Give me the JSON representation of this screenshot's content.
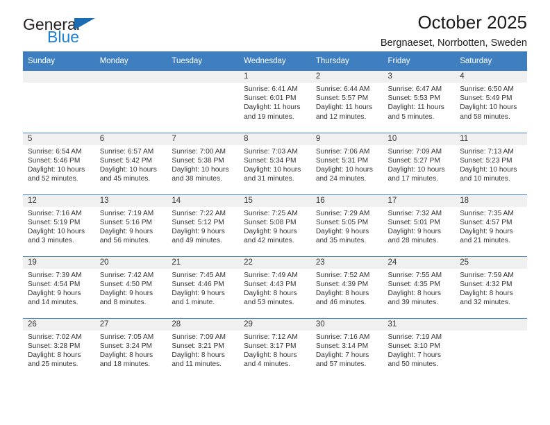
{
  "brand": {
    "name_part1": "General",
    "name_part2": "Blue",
    "triangle_color": "#1b6cb5",
    "blue_color": "#1b7fd4"
  },
  "header": {
    "title": "October 2025",
    "subtitle": "Bergnaeset, Norrbotten, Sweden"
  },
  "theme": {
    "header_bar_color": "#3f7fbf",
    "date_strip_color": "#f0f0f0",
    "text_color": "#333333"
  },
  "weekdays": [
    "Sunday",
    "Monday",
    "Tuesday",
    "Wednesday",
    "Thursday",
    "Friday",
    "Saturday"
  ],
  "weeks": [
    [
      {
        "day": "",
        "sunrise": "",
        "sunset": "",
        "daylight_line1": "",
        "daylight_line2": "",
        "empty": true
      },
      {
        "day": "",
        "sunrise": "",
        "sunset": "",
        "daylight_line1": "",
        "daylight_line2": "",
        "empty": true
      },
      {
        "day": "",
        "sunrise": "",
        "sunset": "",
        "daylight_line1": "",
        "daylight_line2": "",
        "empty": true
      },
      {
        "day": "1",
        "sunrise": "Sunrise: 6:41 AM",
        "sunset": "Sunset: 6:01 PM",
        "daylight_line1": "Daylight: 11 hours",
        "daylight_line2": "and 19 minutes."
      },
      {
        "day": "2",
        "sunrise": "Sunrise: 6:44 AM",
        "sunset": "Sunset: 5:57 PM",
        "daylight_line1": "Daylight: 11 hours",
        "daylight_line2": "and 12 minutes."
      },
      {
        "day": "3",
        "sunrise": "Sunrise: 6:47 AM",
        "sunset": "Sunset: 5:53 PM",
        "daylight_line1": "Daylight: 11 hours",
        "daylight_line2": "and 5 minutes."
      },
      {
        "day": "4",
        "sunrise": "Sunrise: 6:50 AM",
        "sunset": "Sunset: 5:49 PM",
        "daylight_line1": "Daylight: 10 hours",
        "daylight_line2": "and 58 minutes."
      }
    ],
    [
      {
        "day": "5",
        "sunrise": "Sunrise: 6:54 AM",
        "sunset": "Sunset: 5:46 PM",
        "daylight_line1": "Daylight: 10 hours",
        "daylight_line2": "and 52 minutes."
      },
      {
        "day": "6",
        "sunrise": "Sunrise: 6:57 AM",
        "sunset": "Sunset: 5:42 PM",
        "daylight_line1": "Daylight: 10 hours",
        "daylight_line2": "and 45 minutes."
      },
      {
        "day": "7",
        "sunrise": "Sunrise: 7:00 AM",
        "sunset": "Sunset: 5:38 PM",
        "daylight_line1": "Daylight: 10 hours",
        "daylight_line2": "and 38 minutes."
      },
      {
        "day": "8",
        "sunrise": "Sunrise: 7:03 AM",
        "sunset": "Sunset: 5:34 PM",
        "daylight_line1": "Daylight: 10 hours",
        "daylight_line2": "and 31 minutes."
      },
      {
        "day": "9",
        "sunrise": "Sunrise: 7:06 AM",
        "sunset": "Sunset: 5:31 PM",
        "daylight_line1": "Daylight: 10 hours",
        "daylight_line2": "and 24 minutes."
      },
      {
        "day": "10",
        "sunrise": "Sunrise: 7:09 AM",
        "sunset": "Sunset: 5:27 PM",
        "daylight_line1": "Daylight: 10 hours",
        "daylight_line2": "and 17 minutes."
      },
      {
        "day": "11",
        "sunrise": "Sunrise: 7:13 AM",
        "sunset": "Sunset: 5:23 PM",
        "daylight_line1": "Daylight: 10 hours",
        "daylight_line2": "and 10 minutes."
      }
    ],
    [
      {
        "day": "12",
        "sunrise": "Sunrise: 7:16 AM",
        "sunset": "Sunset: 5:19 PM",
        "daylight_line1": "Daylight: 10 hours",
        "daylight_line2": "and 3 minutes."
      },
      {
        "day": "13",
        "sunrise": "Sunrise: 7:19 AM",
        "sunset": "Sunset: 5:16 PM",
        "daylight_line1": "Daylight: 9 hours",
        "daylight_line2": "and 56 minutes."
      },
      {
        "day": "14",
        "sunrise": "Sunrise: 7:22 AM",
        "sunset": "Sunset: 5:12 PM",
        "daylight_line1": "Daylight: 9 hours",
        "daylight_line2": "and 49 minutes."
      },
      {
        "day": "15",
        "sunrise": "Sunrise: 7:25 AM",
        "sunset": "Sunset: 5:08 PM",
        "daylight_line1": "Daylight: 9 hours",
        "daylight_line2": "and 42 minutes."
      },
      {
        "day": "16",
        "sunrise": "Sunrise: 7:29 AM",
        "sunset": "Sunset: 5:05 PM",
        "daylight_line1": "Daylight: 9 hours",
        "daylight_line2": "and 35 minutes."
      },
      {
        "day": "17",
        "sunrise": "Sunrise: 7:32 AM",
        "sunset": "Sunset: 5:01 PM",
        "daylight_line1": "Daylight: 9 hours",
        "daylight_line2": "and 28 minutes."
      },
      {
        "day": "18",
        "sunrise": "Sunrise: 7:35 AM",
        "sunset": "Sunset: 4:57 PM",
        "daylight_line1": "Daylight: 9 hours",
        "daylight_line2": "and 21 minutes."
      }
    ],
    [
      {
        "day": "19",
        "sunrise": "Sunrise: 7:39 AM",
        "sunset": "Sunset: 4:54 PM",
        "daylight_line1": "Daylight: 9 hours",
        "daylight_line2": "and 14 minutes."
      },
      {
        "day": "20",
        "sunrise": "Sunrise: 7:42 AM",
        "sunset": "Sunset: 4:50 PM",
        "daylight_line1": "Daylight: 9 hours",
        "daylight_line2": "and 8 minutes."
      },
      {
        "day": "21",
        "sunrise": "Sunrise: 7:45 AM",
        "sunset": "Sunset: 4:46 PM",
        "daylight_line1": "Daylight: 9 hours",
        "daylight_line2": "and 1 minute."
      },
      {
        "day": "22",
        "sunrise": "Sunrise: 7:49 AM",
        "sunset": "Sunset: 4:43 PM",
        "daylight_line1": "Daylight: 8 hours",
        "daylight_line2": "and 53 minutes."
      },
      {
        "day": "23",
        "sunrise": "Sunrise: 7:52 AM",
        "sunset": "Sunset: 4:39 PM",
        "daylight_line1": "Daylight: 8 hours",
        "daylight_line2": "and 46 minutes."
      },
      {
        "day": "24",
        "sunrise": "Sunrise: 7:55 AM",
        "sunset": "Sunset: 4:35 PM",
        "daylight_line1": "Daylight: 8 hours",
        "daylight_line2": "and 39 minutes."
      },
      {
        "day": "25",
        "sunrise": "Sunrise: 7:59 AM",
        "sunset": "Sunset: 4:32 PM",
        "daylight_line1": "Daylight: 8 hours",
        "daylight_line2": "and 32 minutes."
      }
    ],
    [
      {
        "day": "26",
        "sunrise": "Sunrise: 7:02 AM",
        "sunset": "Sunset: 3:28 PM",
        "daylight_line1": "Daylight: 8 hours",
        "daylight_line2": "and 25 minutes."
      },
      {
        "day": "27",
        "sunrise": "Sunrise: 7:05 AM",
        "sunset": "Sunset: 3:24 PM",
        "daylight_line1": "Daylight: 8 hours",
        "daylight_line2": "and 18 minutes."
      },
      {
        "day": "28",
        "sunrise": "Sunrise: 7:09 AM",
        "sunset": "Sunset: 3:21 PM",
        "daylight_line1": "Daylight: 8 hours",
        "daylight_line2": "and 11 minutes."
      },
      {
        "day": "29",
        "sunrise": "Sunrise: 7:12 AM",
        "sunset": "Sunset: 3:17 PM",
        "daylight_line1": "Daylight: 8 hours",
        "daylight_line2": "and 4 minutes."
      },
      {
        "day": "30",
        "sunrise": "Sunrise: 7:16 AM",
        "sunset": "Sunset: 3:14 PM",
        "daylight_line1": "Daylight: 7 hours",
        "daylight_line2": "and 57 minutes."
      },
      {
        "day": "31",
        "sunrise": "Sunrise: 7:19 AM",
        "sunset": "Sunset: 3:10 PM",
        "daylight_line1": "Daylight: 7 hours",
        "daylight_line2": "and 50 minutes."
      },
      {
        "day": "",
        "sunrise": "",
        "sunset": "",
        "daylight_line1": "",
        "daylight_line2": "",
        "empty": true
      }
    ]
  ]
}
